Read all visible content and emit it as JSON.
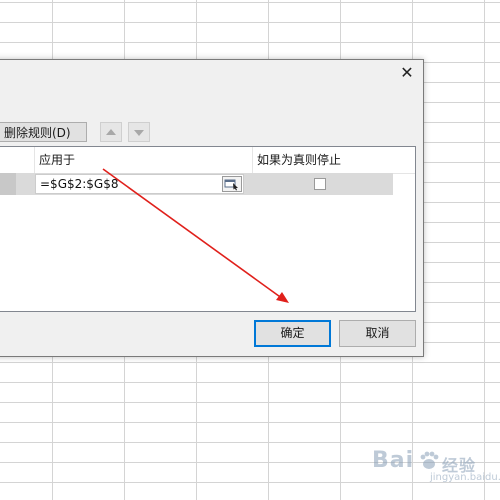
{
  "dialog": {
    "close_label": "✕",
    "toolbar": {
      "delete_rule_label": "删除规则(D)"
    },
    "list": {
      "headers": {
        "applies_to": "应用于",
        "stop_if_true": "如果为真则停止"
      },
      "rows": [
        {
          "applies_to": "=$G$2:$G$8",
          "stop_if_true": false
        }
      ]
    },
    "buttons": {
      "ok": "确定",
      "cancel": "取消"
    }
  },
  "watermark": {
    "brand": "Bai",
    "suffix": "经验",
    "sub": "jingyan.baidu.com"
  },
  "colors": {
    "arrow": "#e0201b",
    "primary_border": "#0078d7",
    "selected_row": "#dadada"
  }
}
